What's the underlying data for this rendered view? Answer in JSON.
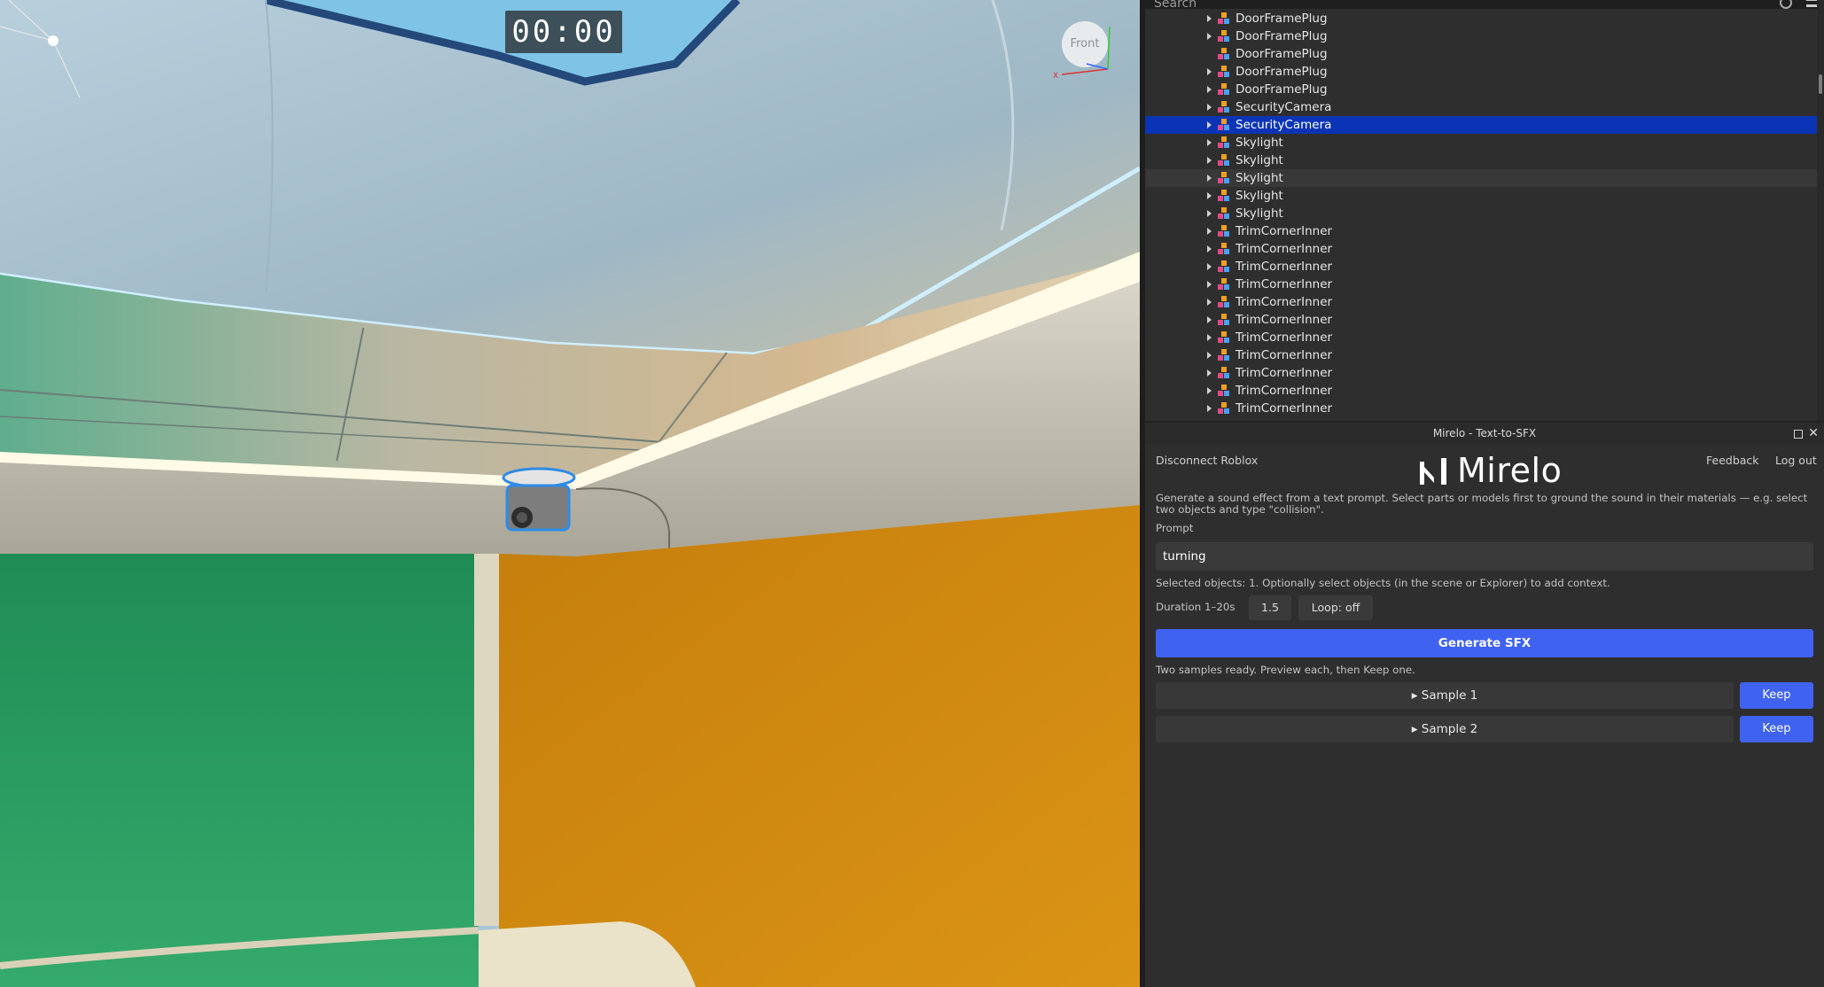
{
  "viewport": {
    "timer": "00:00",
    "view_cube": {
      "face_label": "Front",
      "axis_label": "X"
    }
  },
  "explorer": {
    "search_placeholder": "Search",
    "items": [
      {
        "label": "DoorFramePlug",
        "expandable": true
      },
      {
        "label": "DoorFramePlug",
        "expandable": true
      },
      {
        "label": "DoorFramePlug",
        "expandable": false
      },
      {
        "label": "DoorFramePlug",
        "expandable": true
      },
      {
        "label": "DoorFramePlug",
        "expandable": true
      },
      {
        "label": "SecurityCamera",
        "expandable": true
      },
      {
        "label": "SecurityCamera",
        "expandable": true,
        "selected": true
      },
      {
        "label": "Skylight",
        "expandable": true
      },
      {
        "label": "Skylight",
        "expandable": true
      },
      {
        "label": "Skylight",
        "expandable": true,
        "hovered": true
      },
      {
        "label": "Skylight",
        "expandable": true
      },
      {
        "label": "Skylight",
        "expandable": true
      },
      {
        "label": "TrimCornerInner",
        "expandable": true
      },
      {
        "label": "TrimCornerInner",
        "expandable": true
      },
      {
        "label": "TrimCornerInner",
        "expandable": true
      },
      {
        "label": "TrimCornerInner",
        "expandable": true
      },
      {
        "label": "TrimCornerInner",
        "expandable": true
      },
      {
        "label": "TrimCornerInner",
        "expandable": true
      },
      {
        "label": "TrimCornerInner",
        "expandable": true
      },
      {
        "label": "TrimCornerInner",
        "expandable": true
      },
      {
        "label": "TrimCornerInner",
        "expandable": true
      },
      {
        "label": "TrimCornerInner",
        "expandable": true
      },
      {
        "label": "TrimCornerInner",
        "expandable": true
      }
    ]
  },
  "plugin": {
    "window_title": "Mirelo - Text-to-SFX",
    "disconnect_label": "Disconnect Roblox",
    "brand_name": "Mirelo",
    "feedback_label": "Feedback",
    "logout_label": "Log out",
    "description": "Generate a sound effect from a text prompt. Select parts or models first to ground the sound in their materials — e.g. select two objects and type \"collision\".",
    "prompt_label": "Prompt",
    "prompt_value": "turning",
    "selected_objects_text": "Selected objects: 1. Optionally select objects (in the scene or Explorer) to add context.",
    "duration_label": "Duration 1–20s",
    "duration_value": "1.5",
    "loop_label": "Loop: off",
    "generate_label": "Generate SFX",
    "status_text": "Two samples ready. Preview each, then Keep one.",
    "samples": [
      {
        "label": "▸ Sample 1",
        "keep_label": "Keep"
      },
      {
        "label": "▸ Sample 2",
        "keep_label": "Keep"
      }
    ]
  },
  "colors": {
    "accent": "#3f63f0",
    "selection": "#0a34b5",
    "green_wall": "#2b9a62",
    "orange_wall": "#d08a10"
  }
}
